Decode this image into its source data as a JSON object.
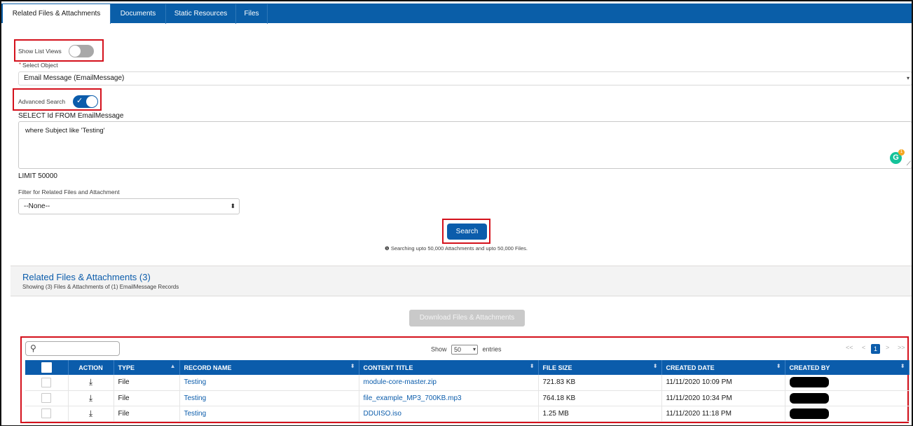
{
  "tabs": [
    {
      "label": "Related Files & Attachments"
    },
    {
      "label": "Documents"
    },
    {
      "label": "Static Resources"
    },
    {
      "label": "Files"
    }
  ],
  "form": {
    "show_list_views_label": "Show List Views",
    "show_list_views_on": false,
    "select_object_required": "*",
    "select_object_label": "Select Object",
    "select_object_value": "Email Message (EmailMessage)",
    "advanced_search_label": "Advanced Search",
    "advanced_search_on": true,
    "query_prefix": "SELECT Id FROM EmailMessage",
    "query_where": "where Subject like 'Testing'",
    "limit_label": "LIMIT 50000",
    "filter_label": "Filter for Related Files and Attachment",
    "filter_value": "--None--",
    "search_button": "Search",
    "search_note": "Searching upto 50,000 Attachments and upto 50,000 Files."
  },
  "grammarly": {
    "letter": "G",
    "badge": "1"
  },
  "results": {
    "title": "Related Files & Attachments (3)",
    "subtitle": "Showing (3) Files & Attachments of (1) EmailMessage Records",
    "download_button": "Download Files & Attachments",
    "show_label": "Show",
    "entries_value": "50",
    "entries_label": "entries",
    "pager": {
      "first": "<<",
      "prev": "<",
      "current": "1",
      "next": ">",
      "last": ">>"
    },
    "columns": [
      "ACTION",
      "TYPE",
      "RECORD NAME",
      "CONTENT TITLE",
      "FILE SIZE",
      "CREATED DATE",
      "CREATED BY"
    ],
    "rows": [
      {
        "type": "File",
        "record_name": "Testing",
        "content_title": "module-core-master.zip",
        "file_size": "721.83 KB",
        "created_date": "11/11/2020 10:09 PM"
      },
      {
        "type": "File",
        "record_name": "Testing",
        "content_title": "file_example_MP3_700KB.mp3",
        "file_size": "764.18 KB",
        "created_date": "11/11/2020 10:34 PM"
      },
      {
        "type": "File",
        "record_name": "Testing",
        "content_title": "DDUISO.iso",
        "file_size": "1.25 MB",
        "created_date": "11/11/2020 11:18 PM"
      }
    ]
  },
  "icons": {
    "download": "download-icon",
    "search": "search-icon",
    "info": "info-icon",
    "sort": "sort-icon"
  },
  "colors": {
    "brand": "#0b5cab",
    "tabbar": "#0a5ea8",
    "highlight": "#d4111c"
  }
}
